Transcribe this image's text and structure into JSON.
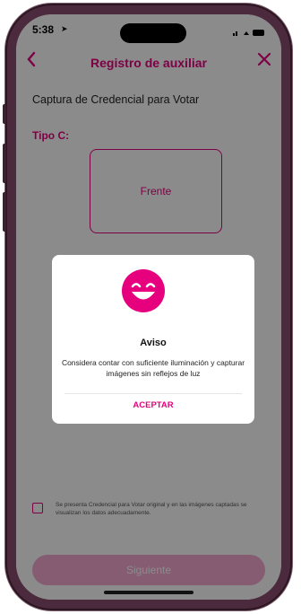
{
  "status_bar": {
    "time": "5:38",
    "location_icon": "location-arrow-icon"
  },
  "header": {
    "back_icon": "chevron-left-icon",
    "title": "Registro de auxiliar",
    "close_icon": "close-icon",
    "accent_color": "#e6007e"
  },
  "page": {
    "subtitle": "Captura de Credencial para Votar",
    "tipo_label": "Tipo C:",
    "frente_label": "Frente"
  },
  "consent": {
    "text": "Se presenta Credencial para Votar original y en las imágenes captadas se visualizan los datos adecuadamente.",
    "checked": false
  },
  "continue_button": {
    "label": "Siguiente",
    "enabled": false
  },
  "modal": {
    "icon": "smiley-face-icon",
    "title": "Aviso",
    "message": "Considera contar con suficiente iluminación y capturar imágenes sin reflejos de luz",
    "accept_label": "ACEPTAR"
  }
}
